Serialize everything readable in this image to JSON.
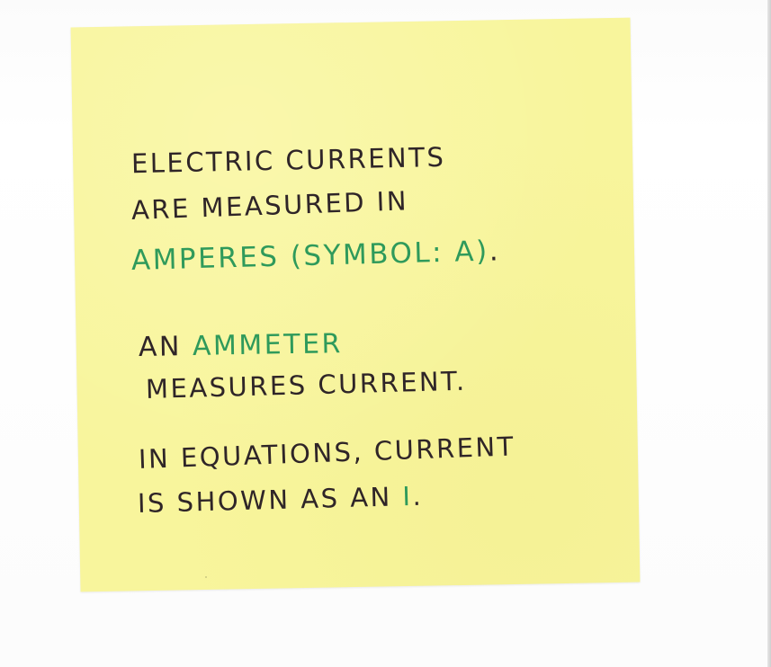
{
  "note": {
    "line1": "ELECTRIC CURRENTS",
    "line2": "ARE MEASURED IN",
    "line3_accent": "AMPERES (SYMBOL: A)",
    "line3_end": ".",
    "line4_start": "AN ",
    "line4_accent": "AMMETER",
    "line5": "MEASURES CURRENT.",
    "line6": "IN EQUATIONS, CURRENT",
    "line7_start": "IS SHOWN AS AN ",
    "line7_accent": "I",
    "line7_end": "."
  },
  "colors": {
    "paper": "#f8f59c",
    "ink": "#2f2528",
    "accent_ink": "#2f9a5b",
    "background": "#ffffff"
  }
}
